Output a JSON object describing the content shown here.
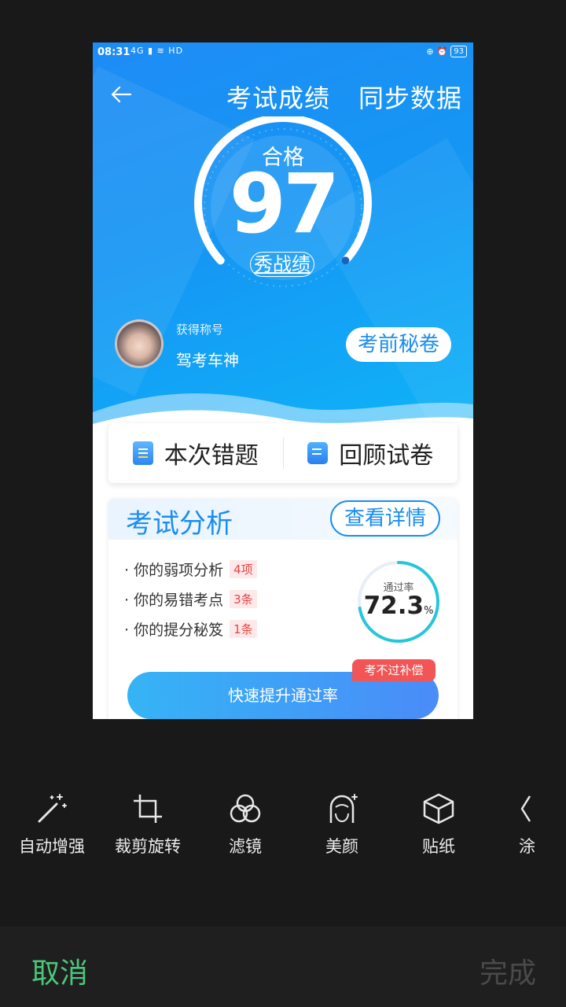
{
  "status_bar": {
    "time": "08:31",
    "signal": "4G",
    "network": "HD",
    "battery": "93"
  },
  "header": {
    "title": "考试成绩",
    "sync_label": "同步数据"
  },
  "score": {
    "label": "合格",
    "value": "97",
    "share_label": "秀战绩"
  },
  "profile": {
    "sub_label": "获得称号",
    "honor": "驾考车神",
    "secret_label": "考前秘卷"
  },
  "actions": {
    "wrong_label": "本次错题",
    "review_label": "回顾试卷"
  },
  "analysis": {
    "title": "考试分析",
    "detail_label": "查看详情",
    "items": [
      {
        "label": "· 你的弱项分析",
        "tag": "4项"
      },
      {
        "label": "· 你的易错考点",
        "tag": "3条"
      },
      {
        "label": "· 你的提分秘笈",
        "tag": "1条"
      }
    ],
    "pass_rate_label": "通过率",
    "pass_rate_value": "72.3",
    "pass_rate_unit": "%",
    "pass_rate_fraction": 0.723,
    "badge": "考不过补偿",
    "cta": "快速提升通过率"
  },
  "toolbar": {
    "items": [
      {
        "label": "自动增强",
        "icon": "magic-wand-icon"
      },
      {
        "label": "裁剪旋转",
        "icon": "crop-icon"
      },
      {
        "label": "滤镜",
        "icon": "filter-icon"
      },
      {
        "label": "美颜",
        "icon": "beauty-icon"
      },
      {
        "label": "贴纸",
        "icon": "sticker-icon"
      },
      {
        "label": "涂",
        "icon": "doodle-icon"
      }
    ]
  },
  "footer": {
    "cancel_label": "取消",
    "done_label": "完成"
  },
  "colors": {
    "accent": "#1a8df0",
    "cancel": "#4bc77a",
    "tag_red": "#ec4444"
  }
}
